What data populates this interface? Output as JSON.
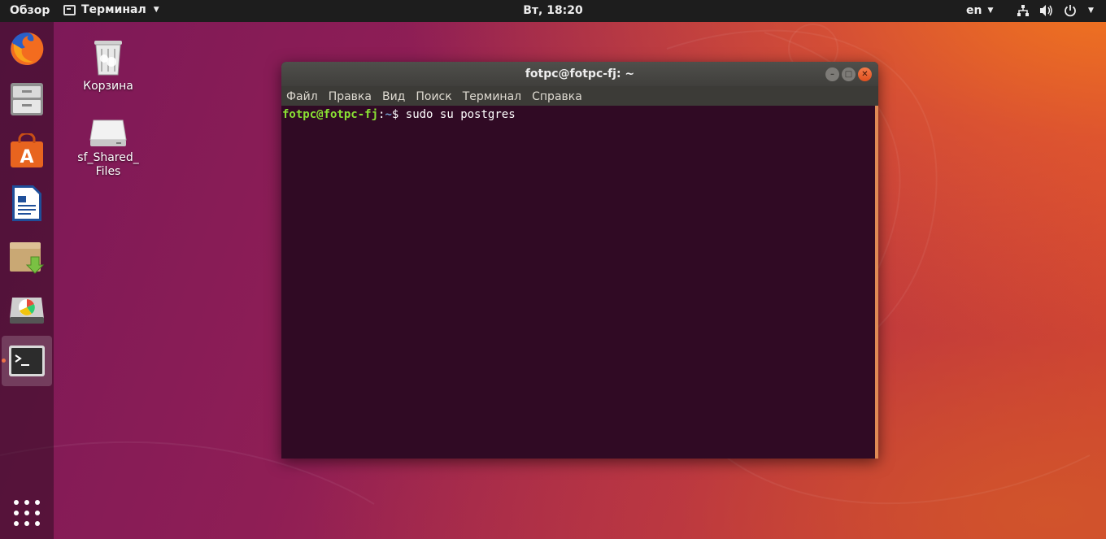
{
  "topbar": {
    "activities": "Обзор",
    "app_menu": "Терминал",
    "clock": "Вт, 18:20",
    "language": "en"
  },
  "desktop": {
    "icons": [
      {
        "label": "Корзина"
      },
      {
        "label": "sf_Shared_\nFiles"
      }
    ]
  },
  "window": {
    "title": "fotpc@fotpc-fj: ~",
    "menu": [
      "Файл",
      "Правка",
      "Вид",
      "Поиск",
      "Терминал",
      "Справка"
    ],
    "terminal": {
      "prompt_user": "fotpc@fotpc-fj",
      "prompt_sep": ":",
      "prompt_path": "~",
      "prompt_symbol": "$",
      "command": "sudo su postgres"
    }
  },
  "colors": {
    "accent": "#e95420",
    "terminal_bg": "#300a24",
    "prompt_user": "#8ae234",
    "prompt_path": "#729fcf"
  }
}
